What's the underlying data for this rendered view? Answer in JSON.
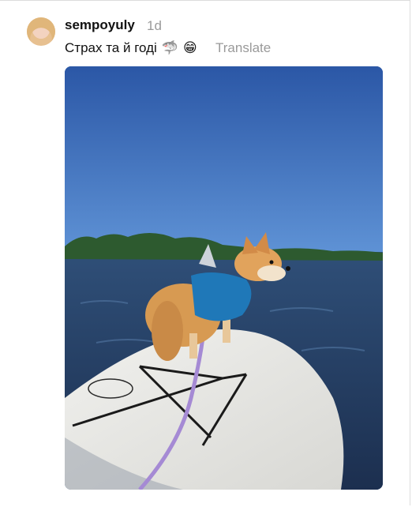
{
  "post": {
    "username": "sempoyuly",
    "time": "1d",
    "caption_text": "Страх та й годі",
    "caption_emojis": [
      "🦈",
      "😁"
    ],
    "translate_label": "Translate"
  },
  "icons": {
    "avatar": "profile-photo",
    "media": "corgi-on-paddleboard-photo"
  }
}
